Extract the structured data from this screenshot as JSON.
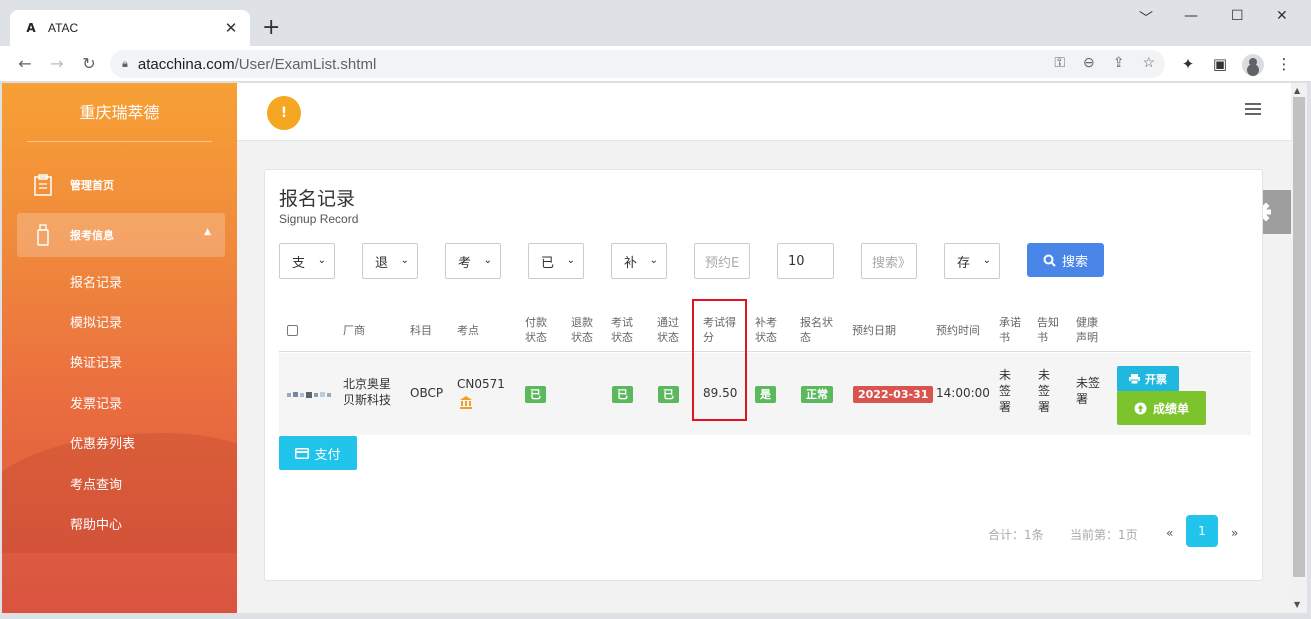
{
  "browser": {
    "tab_title": "ATAC",
    "url_host": "atacchina.com",
    "url_path": "/User/ExamList.shtml",
    "window_controls": [
      "﹀",
      "—",
      "☐",
      "✕"
    ]
  },
  "sidebar": {
    "brand": "重庆瑞萃德",
    "menu": [
      {
        "label": "管理首页"
      },
      {
        "label": "报考信息"
      }
    ],
    "sub_items": [
      "报名记录",
      "模拟记录",
      "换证记录",
      "发票记录",
      "优惠券列表",
      "考点查询",
      "帮助中心"
    ]
  },
  "topbar": {
    "alert_glyph": "!"
  },
  "panel": {
    "title": "报名记录",
    "subtitle": "Signup Record"
  },
  "filters": {
    "f1": "支",
    "f2": "退",
    "f3": "考",
    "f4": "已",
    "f5": "补",
    "date_placeholder": "预约E",
    "page_size": "10",
    "search_placeholder": "搜索》",
    "f6": "存",
    "search_button": "搜索"
  },
  "table": {
    "headers": {
      "vendor": "厂商",
      "subject": "科目",
      "center": "考点",
      "pay_status": "付款状态",
      "refund_status": "退款状态",
      "exam_status": "考试状态",
      "pass_status": "通过状态",
      "score": "考试得分",
      "retake_status": "补考状态",
      "signup_status": "报名状态",
      "date": "预约日期",
      "time": "预约时间",
      "promise": "承诺书",
      "notice": "告知书",
      "health": "健康声明"
    },
    "row": {
      "vendor": "北京奥星贝斯科技",
      "subject": "OBCP",
      "center": "CN0571",
      "pay_status": "已",
      "exam_status": "已",
      "pass_status": "已",
      "score": "89.50",
      "retake_status": "是",
      "signup_status": "正常",
      "date": "2022-03-31",
      "time": "14:00:00",
      "promise": "未签署",
      "notice": "未签署",
      "health": "未签署",
      "invoice_button": "开票",
      "scorecard_button": "成绩单"
    }
  },
  "pay_button": "支付",
  "pagination": {
    "total": "合计：1条",
    "current": "当前第：1页",
    "prev": "«",
    "page": "1",
    "next": "»"
  },
  "colors": {
    "sidebar_top": "#f7a035",
    "sidebar_bottom": "#d9533f",
    "primary_blue": "#4a86e8",
    "cyan": "#21c5eb",
    "green_label": "#5cb85c",
    "red_label": "#d9534f",
    "highlight": "#e0141e"
  }
}
